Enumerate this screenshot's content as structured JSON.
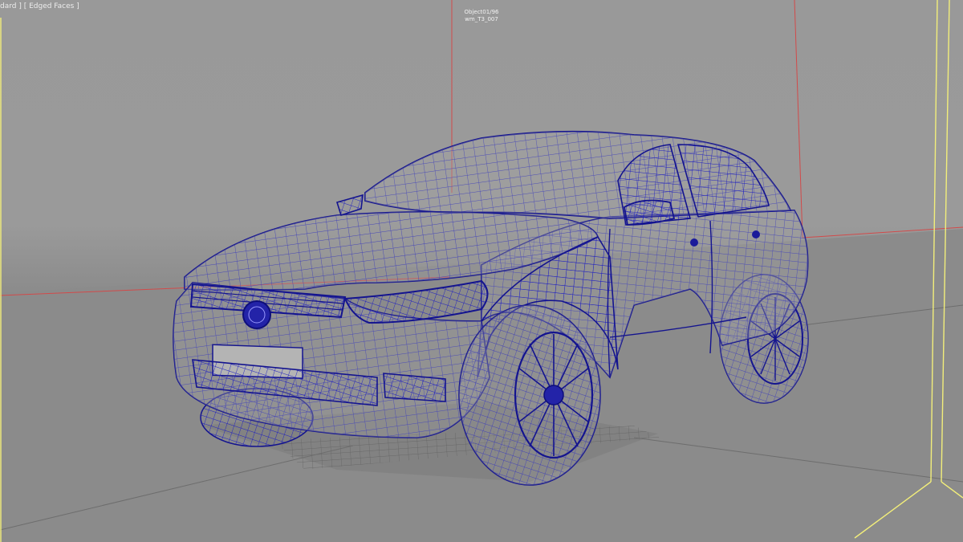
{
  "viewport": {
    "label": "dard ] [ Edged Faces ]",
    "selection_info": {
      "line1": "Object01/96",
      "line2": "wm_T3_007"
    }
  },
  "colors": {
    "background": "#9a9a9a",
    "wireframe": "#1a1ab0",
    "red_axis": "#d24a4a",
    "selection_bracket": "#f2ee7a",
    "label_text": "#ececec"
  },
  "display_mode": "Edged Faces"
}
